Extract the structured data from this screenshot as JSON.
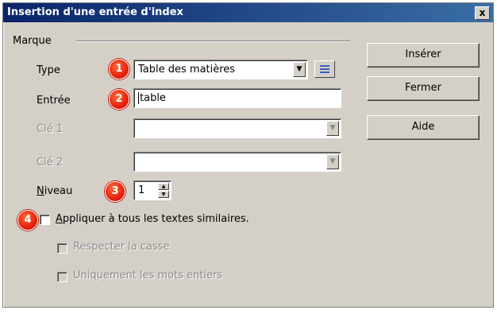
{
  "window": {
    "title": "Insertion d'une entrée d'index",
    "close_label": "x"
  },
  "group": {
    "label": "Marque"
  },
  "fields": {
    "type": {
      "label": "Type",
      "value": "Table des matières"
    },
    "entree": {
      "label": "Entrée",
      "value": "table"
    },
    "cle1": {
      "label": "Clé 1",
      "value": ""
    },
    "cle2": {
      "label": "Clé 2",
      "value": ""
    },
    "niveau": {
      "label_u": "N",
      "label_rest": "iveau",
      "value": "1"
    }
  },
  "options": {
    "apply_all": {
      "label_u": "A",
      "label_rest": "ppliquer à tous les textes similaires.",
      "checked": false
    },
    "match_case": {
      "label": "Respecter la casse",
      "checked": false,
      "disabled": true
    },
    "whole_words": {
      "label": "Uniquement les mots entiers",
      "checked": false,
      "disabled": true
    }
  },
  "buttons": {
    "insert": "Insérer",
    "close": "Fermer",
    "help": "Aide"
  },
  "markers": [
    "1",
    "2",
    "3",
    "4"
  ],
  "colors": {
    "titlebar_start": "#0a246a",
    "titlebar_end": "#3a6ea5",
    "dialog_bg": "#d4d0c8",
    "marker": "#e8200a"
  }
}
